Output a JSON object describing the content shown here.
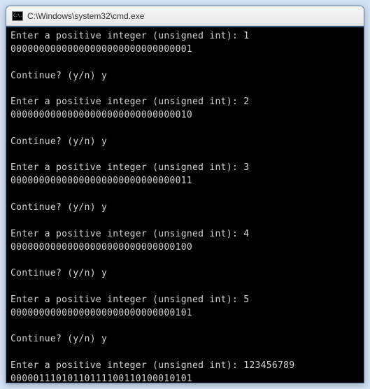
{
  "window": {
    "icon_label": "C:\\.",
    "title": "C:\\Windows\\system32\\cmd.exe"
  },
  "prompts": {
    "enter": "Enter a positive integer (unsigned int): ",
    "continue": "Continue? (y/n) "
  },
  "entries": [
    {
      "input": "1",
      "output": "00000000000000000000000000000001",
      "answer": "y"
    },
    {
      "input": "2",
      "output": "00000000000000000000000000000010",
      "answer": "y"
    },
    {
      "input": "3",
      "output": "00000000000000000000000000000011",
      "answer": "y"
    },
    {
      "input": "4",
      "output": "00000000000000000000000000000100",
      "answer": "y"
    },
    {
      "input": "5",
      "output": "00000000000000000000000000000101",
      "answer": "y"
    },
    {
      "input": "123456789",
      "output": "00000111010110111100110100010101",
      "answer": ""
    }
  ]
}
